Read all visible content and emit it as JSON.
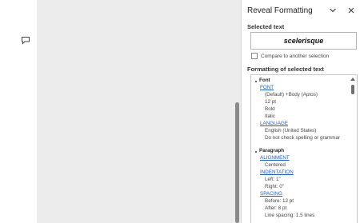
{
  "pane": {
    "title": "Reveal Formatting",
    "selected_text_label": "Selected text",
    "selected_text_value": "scelerisque",
    "compare_label": "Compare to another selection",
    "formatting_label": "Formatting of selected text"
  },
  "formatting": {
    "font": {
      "heading": "Font",
      "link": "FONT",
      "items": [
        "(Default) +Body (Aptos)",
        "12 pt",
        "Bold",
        "Italic"
      ],
      "language_link": "LANGUAGE",
      "language_items": [
        "English (United States)",
        "Do not check spelling or grammar"
      ]
    },
    "paragraph": {
      "heading": "Paragraph",
      "alignment_link": "ALIGNMENT",
      "alignment_value": "Centered",
      "indentation_link": "INDENTATION",
      "indentation_items": [
        "Left:  1\"",
        "Right:  0\""
      ],
      "spacing_link": "SPACING",
      "spacing_items": [
        "Before:  12 pt",
        "After:  8 pt",
        "Line spacing:  1.5 lines"
      ]
    }
  }
}
